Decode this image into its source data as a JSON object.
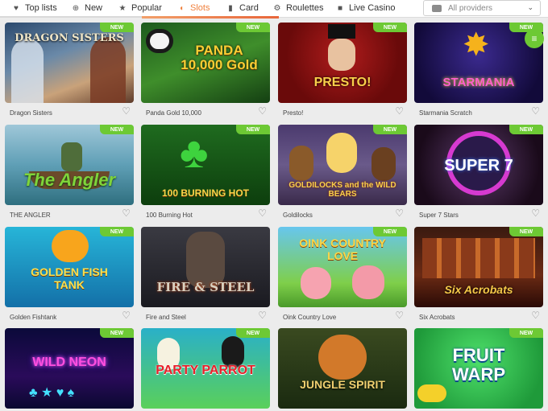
{
  "nav": {
    "tabs": [
      {
        "label": "Top lists",
        "icon": "heart-icon"
      },
      {
        "label": "New",
        "icon": "plus-circle-icon"
      },
      {
        "label": "Popular",
        "icon": "star-icon"
      },
      {
        "label": "Slots",
        "icon": "slots-icon"
      },
      {
        "label": "Card",
        "icon": "card-icon"
      },
      {
        "label": "Roulettes",
        "icon": "roulette-icon"
      },
      {
        "label": "Live Casino",
        "icon": "live-dealer-icon"
      }
    ],
    "active_tab": "Slots",
    "providers_dropdown": {
      "value": "All providers",
      "icon": "gamepad-icon"
    }
  },
  "badge_label": "NEW",
  "games": [
    {
      "title": "Dragon Sisters",
      "logo": "DRAGON SISTERS",
      "new": true
    },
    {
      "title": "Panda Gold 10,000",
      "logo": "PANDA 10,000 Gold",
      "new": true
    },
    {
      "title": "Presto!",
      "logo": "PRESTO!",
      "new": true
    },
    {
      "title": "Starmania Scratch",
      "logo": "STARMANIA",
      "new": true
    },
    {
      "title": "THE ANGLER",
      "logo": "The Angler",
      "new": true
    },
    {
      "title": "100 Burning Hot",
      "logo": "100 BURNING HOT",
      "new": true
    },
    {
      "title": "Goldilocks",
      "logo": "GOLDILOCKS and the WILD BEARS",
      "new": true
    },
    {
      "title": "Super 7 Stars",
      "logo": "SUPER 7",
      "new": true
    },
    {
      "title": "Golden Fishtank",
      "logo": "GOLDEN FISH TANK",
      "new": true
    },
    {
      "title": "Fire and Steel",
      "logo": "FIRE & STEEL",
      "new": false
    },
    {
      "title": "Oink Country Love",
      "logo": "OINK COUNTRY LOVE",
      "new": true
    },
    {
      "title": "Six Acrobats",
      "logo": "Six Acrobats",
      "new": true
    },
    {
      "title": "",
      "logo": "WILD NEON",
      "new": true
    },
    {
      "title": "",
      "logo": "PARTY PARROT",
      "new": true
    },
    {
      "title": "",
      "logo": "JUNGLE SPIRIT",
      "new": false
    },
    {
      "title": "",
      "logo": "FRUIT WARP",
      "new": true
    }
  ]
}
